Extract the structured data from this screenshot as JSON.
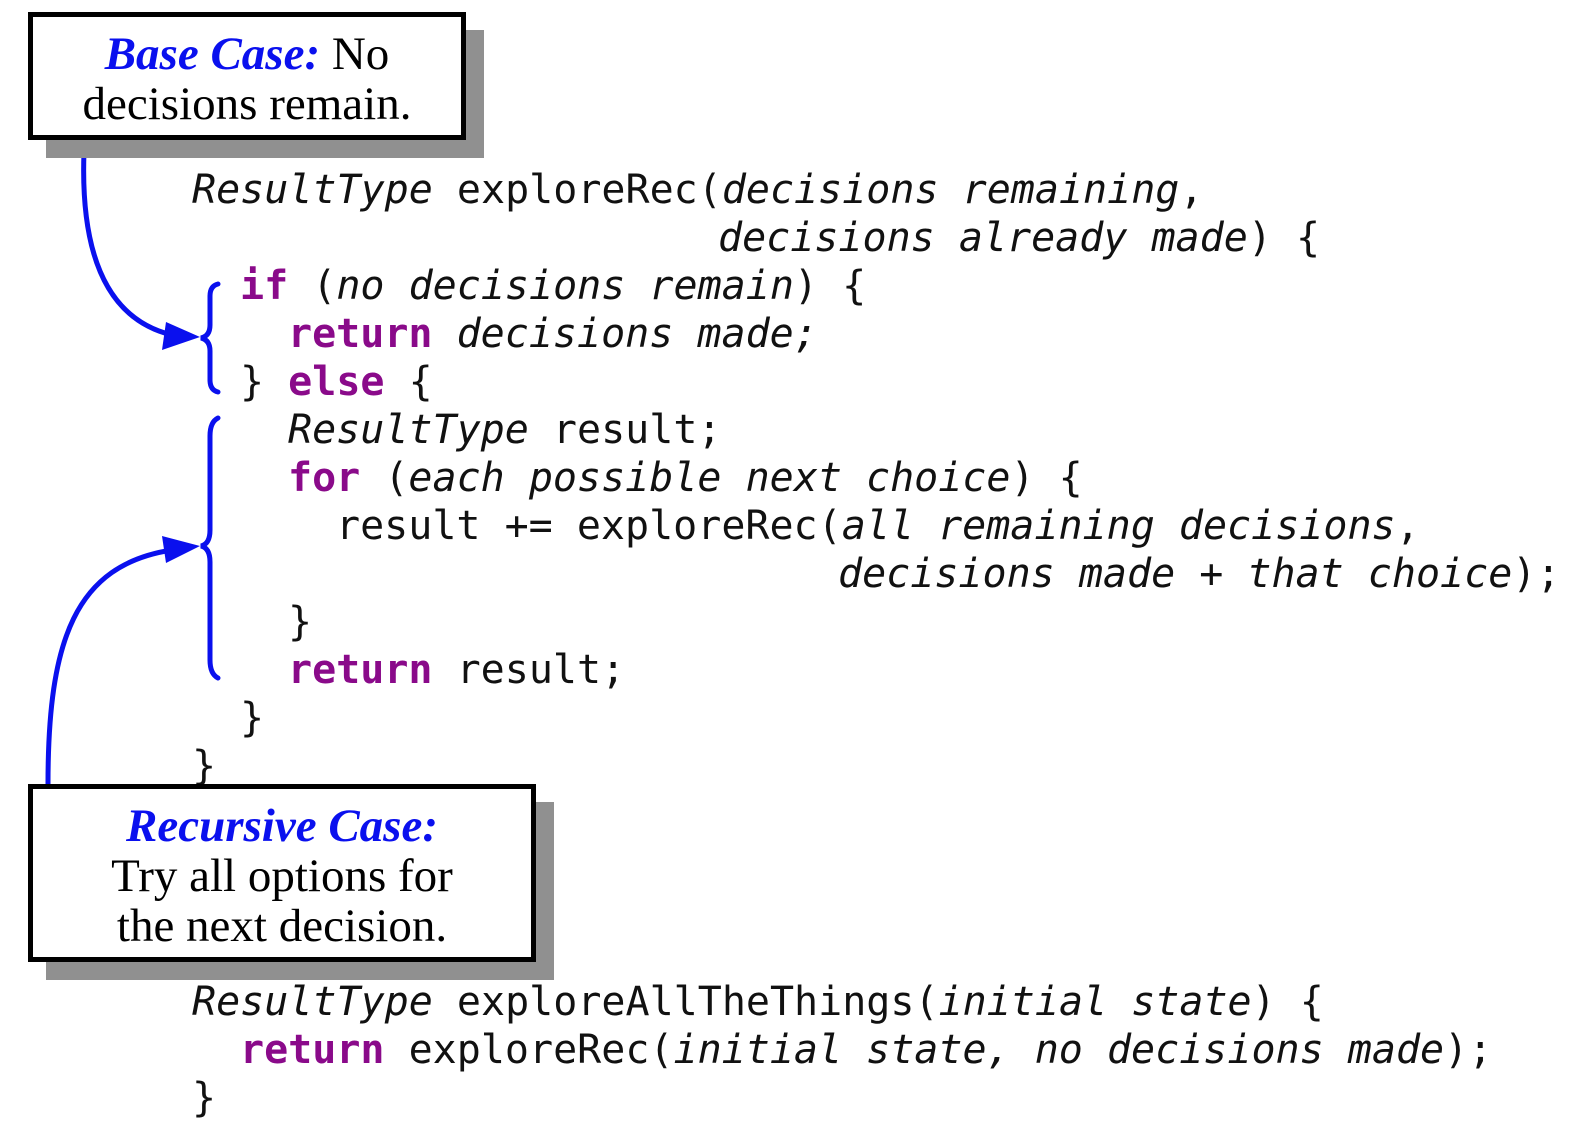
{
  "annotation_color": "#0a10ee",
  "keyword_color": "#8a0a8a",
  "callouts": {
    "base_case": {
      "heading": "Base Case:",
      "text_line1": "No",
      "text_line2": "decisions remain."
    },
    "recursive_case": {
      "heading": "Recursive Case:",
      "text_line1": "Try all options for",
      "text_line2": "the next decision."
    }
  },
  "code": {
    "line1": {
      "type": "ResultType",
      "name": " exploreRec(",
      "param": "decisions remaining",
      "tail": ","
    },
    "line2": {
      "param": "decisions already made",
      "tail": ") {"
    },
    "line3": {
      "kw": "if",
      "open": " (",
      "cond": "no decisions remain",
      "tail": ") {"
    },
    "line4": {
      "kw": "return",
      "value": "decisions made;"
    },
    "line5": {
      "close": "} ",
      "kw": "else",
      "tail": " {"
    },
    "line6": {
      "type": "ResultType",
      "tail": " result;"
    },
    "line7": {
      "kw": "for",
      "open": " (",
      "cond": "each possible next choice",
      "tail": ") {"
    },
    "line8": {
      "head": "result += exploreRec(",
      "param": "all remaining decisions",
      "tail": ","
    },
    "line9": {
      "param": "decisions made + that choice",
      "tail": ");"
    },
    "line10": {
      "text": "}"
    },
    "line11": {
      "kw": "return",
      "tail": " result;"
    },
    "line12": {
      "text": "}"
    },
    "line13": {
      "text": "}"
    },
    "line14": {
      "type": "ResultType",
      "name": " exploreAllTheThings(",
      "param": "initial state",
      "tail": ") {"
    },
    "line15": {
      "kw": "return",
      "head": " exploreRec(",
      "param": "initial state, no decisions made",
      "tail": ");"
    },
    "line16": {
      "text": "}"
    }
  }
}
